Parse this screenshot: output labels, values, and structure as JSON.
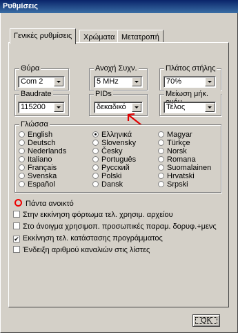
{
  "window": {
    "title": "Ρυθμίσεις"
  },
  "tabs": [
    {
      "label": "Γενικές ρυθμίσεις",
      "active": true
    },
    {
      "label": "Χρώματα",
      "active": false
    },
    {
      "label": "Μετατροπή",
      "active": false
    }
  ],
  "groups": {
    "port": {
      "label": "Θύρα",
      "value": "Com 2"
    },
    "freq": {
      "label": "Ανοχή Συχν.",
      "value": "5 MHz"
    },
    "width": {
      "label": "Πλάτος στήλης",
      "value": "70%"
    },
    "baud": {
      "label": "Baudrate",
      "value": "115200"
    },
    "pids": {
      "label": "PIDs",
      "value": "δεκαδικό"
    },
    "reduce": {
      "label": "Μείωση μήκ. ονόμ.",
      "value": "Τέλος"
    }
  },
  "language": {
    "label": "Γλώσσα",
    "selected": "Ελληνικά",
    "col1": [
      "English",
      "Deutsch",
      "Nederlands",
      "Italiano",
      "Français",
      "Svenska",
      "Español"
    ],
    "col2": [
      "Ελληνικά",
      "Slovensky",
      "Česky",
      "Português",
      "Русский",
      "Polski",
      "Dansk"
    ],
    "col3": [
      "Magyar",
      "Türkçe",
      "Norsk",
      "Romana",
      "Suomalainen",
      "Hrvatski",
      "Srpski"
    ]
  },
  "options": [
    {
      "label": "Πάντα ανοικτό",
      "checked": false
    },
    {
      "label": "Στην εκκίνηση φόρτωμα τελ. χρησιμ. αρχείου",
      "checked": false
    },
    {
      "label": "Στο άνοιγμα χρησιμοπ. προσωπικές παραμ. δορυφ.+μενς",
      "checked": false
    },
    {
      "label": "Εκκίνηση τελ. κατάστασης προγράμματος",
      "checked": true
    },
    {
      "label": "Ένδειξη αριθμού καναλιών στις λίστες",
      "checked": false
    }
  ],
  "ok_button": {
    "label": "OK"
  },
  "annotations": {
    "marker_color": "#e00000"
  }
}
